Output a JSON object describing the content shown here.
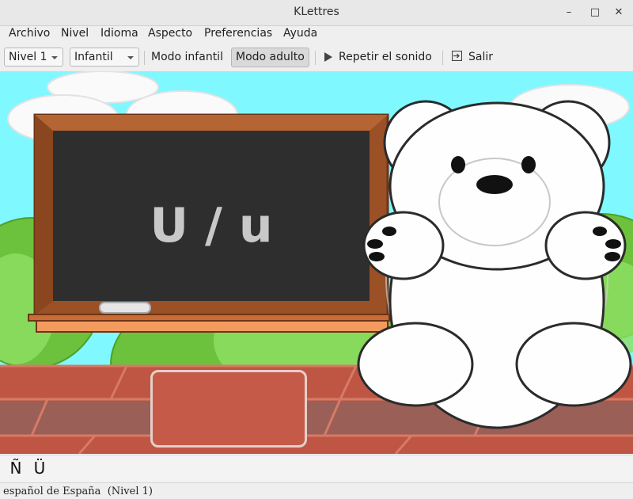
{
  "window": {
    "title": "KLettres",
    "minimize": "–",
    "maximize": "□",
    "close": "✕"
  },
  "menu": [
    {
      "id": "archivo",
      "label": "Archivo"
    },
    {
      "id": "nivel",
      "label": "Nivel"
    },
    {
      "id": "idioma",
      "label": "Idioma"
    },
    {
      "id": "aspecto",
      "label": "Aspecto"
    },
    {
      "id": "preferencias",
      "label": "Preferencias"
    },
    {
      "id": "ayuda",
      "label": "Ayuda"
    }
  ],
  "toolbar": {
    "level_combo": "Nivel 1",
    "theme_combo": "Infantil",
    "kid_mode": "Modo infantil",
    "adult_mode": "Modo adulto",
    "repeat_sound": "Repetir el sonido",
    "quit": "Salir"
  },
  "board": {
    "letter": "U / u"
  },
  "special_chars": [
    "Ñ",
    "Ü"
  ],
  "status": {
    "text": "español de España  (Nivel 1)"
  },
  "colors": {
    "sky": "#7ff9ff",
    "board": "#2e2e2e",
    "frame": "#9b5026",
    "brick": "#c65a48",
    "grass": "#7cd24a"
  },
  "icons": {
    "play": "play-icon",
    "exit": "exit-icon"
  }
}
